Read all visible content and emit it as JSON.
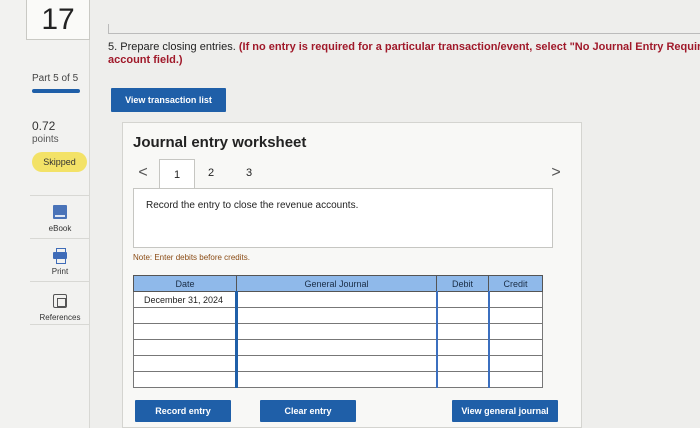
{
  "question": {
    "number": "17",
    "part_label": "Part 5 of 5",
    "part_progress": 1.0,
    "score": "0.72",
    "points_label": "points",
    "status_badge": "Skipped"
  },
  "tools": [
    {
      "label": "eBook",
      "icon": "ebook-icon"
    },
    {
      "label": "Print",
      "icon": "print-icon"
    },
    {
      "label": "References",
      "icon": "references-icon"
    }
  ],
  "prompt": {
    "number_text": "5. Prepare closing entries.",
    "instruction": "(If no entry is required for a particular transaction/event, select \"No Journal Entry Require",
    "instruction_line2": "account field.)"
  },
  "view_transaction_list_label": "View transaction list",
  "worksheet": {
    "title": "Journal entry worksheet",
    "prev_label": "<",
    "next_label": ">",
    "pages": [
      "1",
      "2",
      "3"
    ],
    "active_page": "1",
    "record_text": "Record the entry to close the revenue accounts.",
    "note": "Note: Enter debits before credits."
  },
  "journal_table": {
    "headers": [
      "Date",
      "General Journal",
      "Debit",
      "Credit"
    ],
    "rows": [
      [
        "December 31, 2024",
        "",
        "",
        ""
      ],
      [
        "",
        "",
        "",
        ""
      ],
      [
        "",
        "",
        "",
        ""
      ],
      [
        "",
        "",
        "",
        ""
      ],
      [
        "",
        "",
        "",
        ""
      ],
      [
        "",
        "",
        "",
        ""
      ]
    ]
  },
  "actions": {
    "record_entry": "Record entry",
    "clear_entry": "Clear entry",
    "view_general_journal": "View general journal"
  },
  "colors": {
    "accent_blue": "#1f5fa8",
    "header_blue": "#8fb9ea",
    "skipped_yellow": "#f3e267",
    "instruction_red": "#a0192a"
  }
}
